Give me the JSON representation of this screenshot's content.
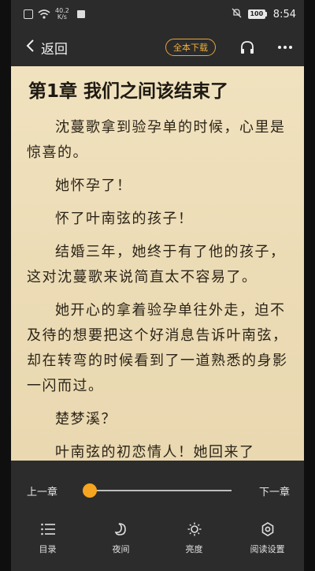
{
  "status_bar": {
    "net_speed_value": "40.2",
    "net_speed_unit": "K/s",
    "battery": "100",
    "time": "8:54"
  },
  "header": {
    "back_label": "返回",
    "download_label": "全本下载",
    "accent_color": "#e8a33a"
  },
  "chapter": {
    "title": "第1章 我们之间该结束了",
    "paragraphs": [
      "沈蔓歌拿到验孕单的时候，心里是惊喜的。",
      "她怀孕了！",
      "怀了叶南弦的孩子！",
      "结婚三年，她终于有了他的孩子，这对沈蔓歌来说简直太不容易了。",
      "她开心的拿着验孕单往外走，迫不及待的想要把这个好消息告诉叶南弦，却在转弯的时候看到了一道熟悉的身影一闪而过。",
      "楚梦溪？",
      "叶南弦的初恋情人！她回来了"
    ]
  },
  "reader_panel": {
    "prev_chapter": "上一章",
    "next_chapter": "下一章",
    "progress": 0.02,
    "tabs": [
      {
        "label": "目录",
        "icon": "list-icon"
      },
      {
        "label": "夜间",
        "icon": "moon-icon"
      },
      {
        "label": "亮度",
        "icon": "brightness-icon"
      },
      {
        "label": "阅读设置",
        "icon": "gear-icon"
      }
    ]
  }
}
